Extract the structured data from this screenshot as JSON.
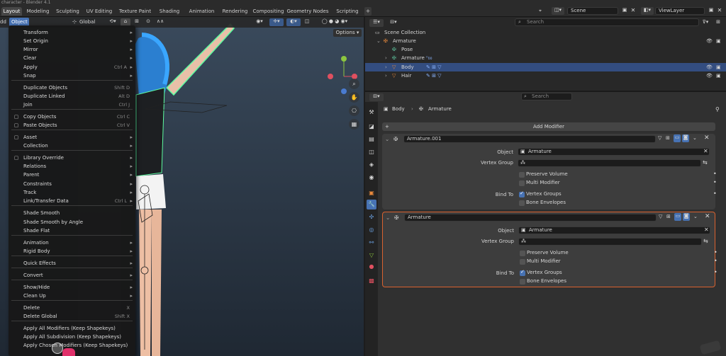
{
  "window": {
    "title": "character - Blender 4.1"
  },
  "workspace_tabs": [
    {
      "label": "Layout",
      "active": true
    },
    {
      "label": "Modeling"
    },
    {
      "label": "Sculpting"
    },
    {
      "label": "UV Editing"
    },
    {
      "label": "Texture Paint"
    },
    {
      "label": "Shading"
    },
    {
      "label": "Animation"
    },
    {
      "label": "Rendering"
    },
    {
      "label": "Compositing"
    },
    {
      "label": "Geometry Nodes"
    },
    {
      "label": "Scripting"
    }
  ],
  "topbar": {
    "add_tab": "+",
    "scene": "Scene",
    "view_layer": "ViewLayer"
  },
  "viewport_header": {
    "add_menu": "dd",
    "object_menu": "Object",
    "orientation": "Global",
    "options": "Options"
  },
  "object_menu": {
    "items": [
      {
        "label": "Transform",
        "submenu": true
      },
      {
        "label": "Set Origin",
        "submenu": true
      },
      {
        "label": "Mirror",
        "submenu": true
      },
      {
        "label": "Clear",
        "submenu": true
      },
      {
        "label": "Apply",
        "shortcut": "Ctrl A",
        "submenu": true
      },
      {
        "label": "Snap",
        "submenu": true
      },
      {
        "label": "Duplicate Objects",
        "shortcut": "Shift D"
      },
      {
        "label": "Duplicate Linked",
        "shortcut": "Alt D"
      },
      {
        "label": "Join",
        "shortcut": "Ctrl J"
      },
      {
        "label": "Copy Objects",
        "shortcut": "Ctrl C",
        "icon": "copy-icon"
      },
      {
        "label": "Paste Objects",
        "shortcut": "Ctrl V",
        "icon": "paste-icon"
      },
      {
        "label": "Asset",
        "submenu": true,
        "icon": "asset-icon"
      },
      {
        "label": "Collection",
        "submenu": true
      },
      {
        "label": "Library Override",
        "submenu": true,
        "icon": "library-override-icon"
      },
      {
        "label": "Relations",
        "submenu": true
      },
      {
        "label": "Parent",
        "submenu": true
      },
      {
        "label": "Constraints",
        "submenu": true
      },
      {
        "label": "Track",
        "submenu": true
      },
      {
        "label": "Link/Transfer Data",
        "shortcut": "Ctrl L",
        "submenu": true
      },
      {
        "label": "Shade Smooth"
      },
      {
        "label": "Shade Smooth by Angle"
      },
      {
        "label": "Shade Flat"
      },
      {
        "label": "Animation",
        "submenu": true
      },
      {
        "label": "Rigid Body",
        "submenu": true
      },
      {
        "label": "Quick Effects",
        "submenu": true
      },
      {
        "label": "Convert",
        "submenu": true
      },
      {
        "label": "Show/Hide",
        "submenu": true
      },
      {
        "label": "Clean Up",
        "submenu": true
      },
      {
        "label": "Delete",
        "shortcut": "X"
      },
      {
        "label": "Delete Global",
        "shortcut": "Shift X"
      },
      {
        "label": "Apply All Modifiers (Keep Shapekeys)"
      },
      {
        "label": "Apply All Subdivision (Keep Shapekeys)"
      },
      {
        "label": "Apply Chosen Modifiers (Keep Shapekeys)"
      }
    ]
  },
  "outliner": {
    "search_placeholder": "Search",
    "rows": [
      {
        "label": "Scene Collection",
        "indent": 0
      },
      {
        "label": "Armature",
        "indent": 1
      },
      {
        "label": "Pose",
        "indent": 2
      },
      {
        "label": "Armature",
        "indent": 2
      },
      {
        "label": "Body",
        "indent": 2,
        "selected": true
      },
      {
        "label": "Hair",
        "indent": 2
      }
    ]
  },
  "properties": {
    "search_placeholder": "Search",
    "breadcrumb": [
      "Body",
      "Armature"
    ],
    "add_modifier": "Add Modifier",
    "modifiers": [
      {
        "name": "Armature.001",
        "object_label": "Object",
        "object_value": "Armature",
        "vertex_group_label": "Vertex Group",
        "preserve_volume": "Preserve Volume",
        "multi_modifier": "Multi Modifier",
        "bind_to_label": "Bind To",
        "vertex_groups": "Vertex Groups",
        "bone_envelopes": "Bone Envelopes",
        "active": false
      },
      {
        "name": "Armature",
        "object_label": "Object",
        "object_value": "Armature",
        "vertex_group_label": "Vertex Group",
        "preserve_volume": "Preserve Volume",
        "multi_modifier": "Multi Modifier",
        "bind_to_label": "Bind To",
        "vertex_groups": "Vertex Groups",
        "bone_envelopes": "Bone Envelopes",
        "active": true
      }
    ]
  },
  "colors": {
    "accent": "#4772b3",
    "selected_row": "#334d80",
    "active_outline": "#d9612e",
    "bone_highlight": "#5dfca0"
  }
}
